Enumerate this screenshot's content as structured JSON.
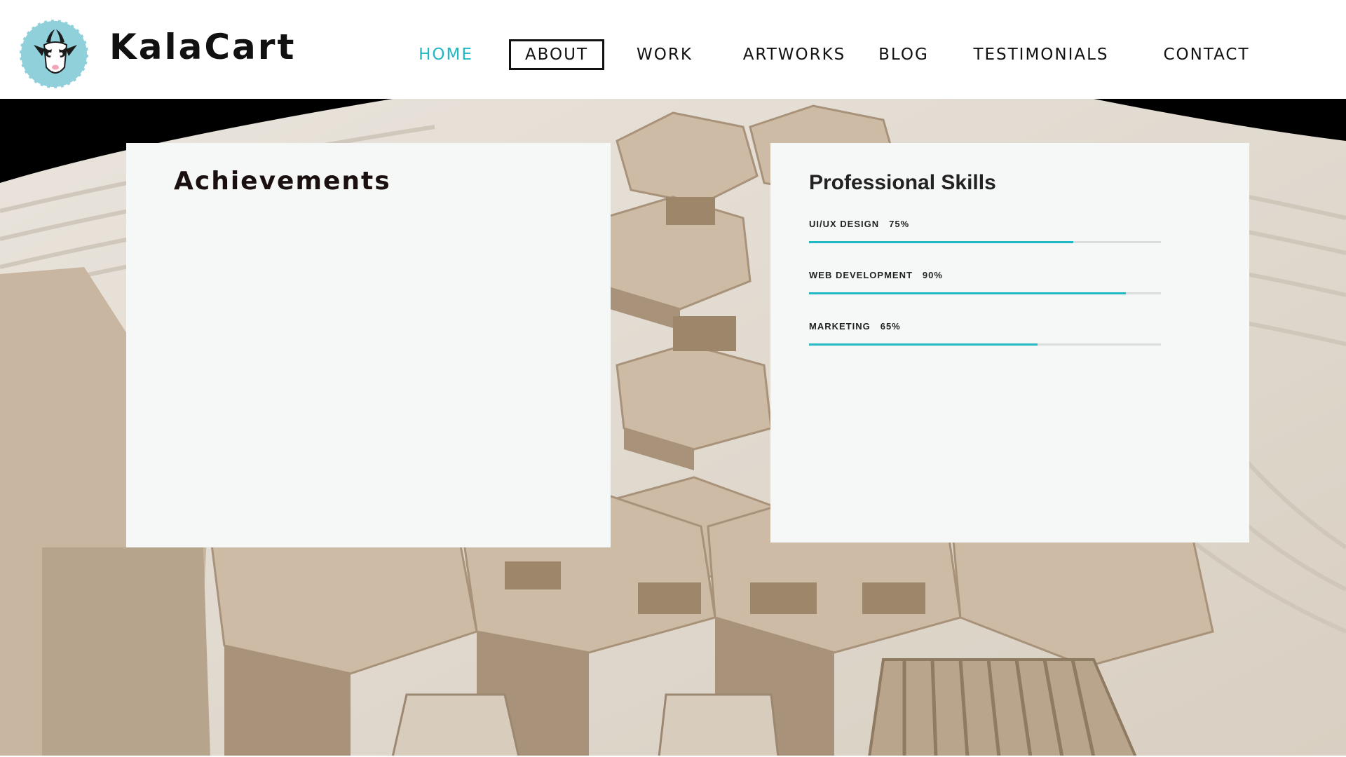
{
  "brand": {
    "name": "KalaCart",
    "logo_icon": "goat-mascot-icon"
  },
  "nav": {
    "items": [
      {
        "label": "HOME",
        "state": "active"
      },
      {
        "label": "ABOUT",
        "state": "boxed"
      },
      {
        "label": "WORK"
      },
      {
        "label": "ARTWORKS"
      },
      {
        "label": "BLOG"
      },
      {
        "label": "TESTIMONIALS"
      },
      {
        "label": "CONTACT"
      }
    ]
  },
  "achievements": {
    "title": "Achievements"
  },
  "skills": {
    "title": "Professional Skills",
    "items": [
      {
        "name": "UI/UX DESIGN",
        "percent_label": "75%",
        "value": 75
      },
      {
        "name": "WEB DEVELOPMENT",
        "percent_label": "90%",
        "value": 90
      },
      {
        "name": "MARKETING",
        "percent_label": "65%",
        "value": 65
      }
    ]
  },
  "colors": {
    "accent": "#21b8c3",
    "card_bg": "#f6f7f7",
    "text": "#111111"
  }
}
